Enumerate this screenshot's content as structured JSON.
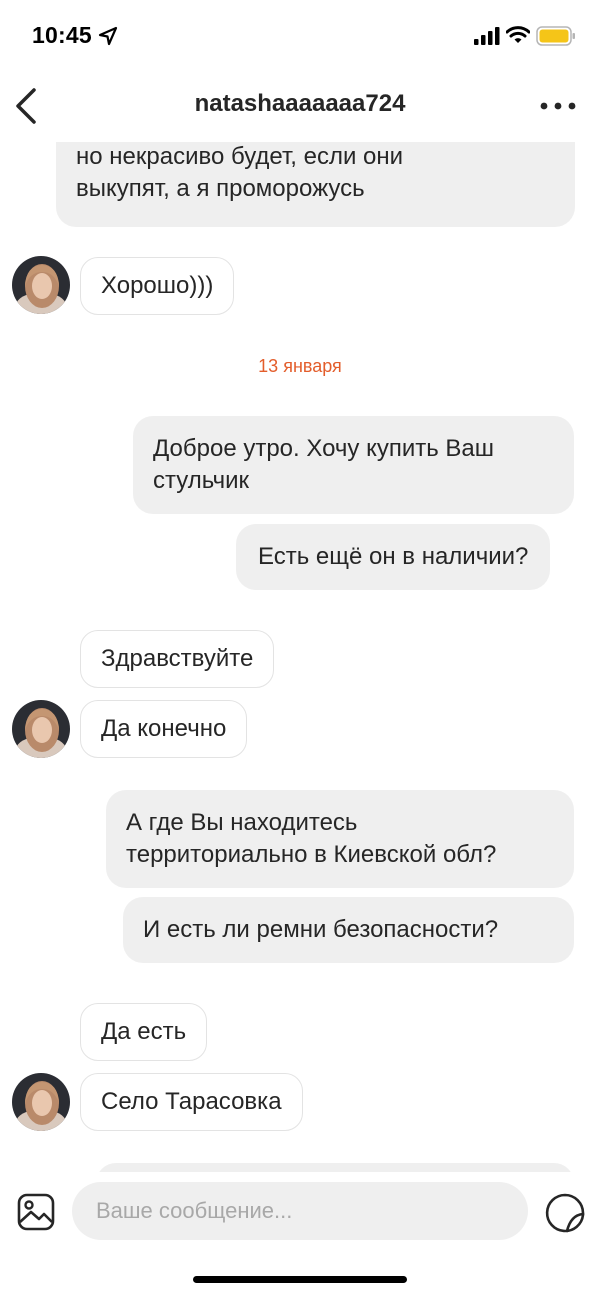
{
  "status_bar": {
    "time": "10:45",
    "location_icon": "location-arrow-icon",
    "signal_icon": "cellular-signal-icon",
    "wifi_icon": "wifi-icon",
    "battery_icon": "battery-icon",
    "battery_color": "#f5c518"
  },
  "header": {
    "back_icon": "chevron-left-icon",
    "title": "natashaaaaaaa724",
    "more_icon": "more-horizontal-icon"
  },
  "chat": {
    "date_color": "#e35d2b",
    "messages": [
      {
        "text": "но некрасиво будет, если они\nвыкупят, а я проморожусь"
      },
      {
        "text": "Хорошо)))"
      },
      {
        "date": "13 января"
      },
      {
        "text": "Доброе утро. Хочу купить Ваш\nстульчик"
      },
      {
        "text": "Есть ещё он в наличии?"
      },
      {
        "text": "Здравствуйте"
      },
      {
        "text": "Да конечно"
      },
      {
        "text": "А где Вы находитесь\nтерриториально в Киевской обл?"
      },
      {
        "text": "И есть ли ремни безопасности?"
      },
      {
        "text": "Да есть"
      },
      {
        "text": "Село Тарасовка"
      }
    ]
  },
  "composer": {
    "gallery_icon": "image-icon",
    "placeholder": "Ваше сообщение...",
    "sticker_icon": "sticker-icon"
  }
}
